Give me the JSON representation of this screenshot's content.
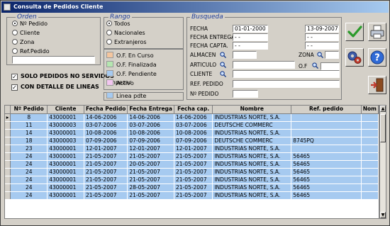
{
  "window": {
    "title": "Consulta de Pedidos Cliente"
  },
  "orden": {
    "legend": "Orden",
    "options": [
      "Nº Pedido",
      "Cliente",
      "Zona",
      "Ref.Pedido"
    ],
    "selected": 0,
    "input_value": ""
  },
  "checks": {
    "solo_pedidos": {
      "label": "SOLO PEDIDOS NO SERVIDOS",
      "checked": true
    },
    "con_detalle": {
      "label": "CON DETALLE DE LINEAS",
      "checked": true
    }
  },
  "rango": {
    "legend": "Rango",
    "options": [
      "Todos",
      "Nacionales",
      "Extranjeros"
    ],
    "selected": 0
  },
  "status_legend": [
    {
      "label": "O.F. En Curso",
      "color": "#f4c69f"
    },
    {
      "label": "O.F. Finalizada",
      "color": "#b5e6b0"
    },
    {
      "label": "O.F. Pendiente Empezar",
      "color": "#a6caf0"
    },
    {
      "label": "Activo",
      "color": "#f2c6f0"
    }
  ],
  "linea_pdte": {
    "label": "Linea pdte",
    "color": "#a6caf0"
  },
  "busqueda": {
    "legend": "Busqueda",
    "fecha_label": "FECHA",
    "fecha_from": "01-01-2000",
    "fecha_to": "13-09-2007",
    "fecha_entrega_label": "FECHA ENTREGA",
    "fecha_entrega_from": " - -",
    "fecha_entrega_to": " - -",
    "fecha_capta_label": "FECHA CAPTA.",
    "fecha_capta_from": " - -",
    "fecha_capta_to": " - -",
    "almacen_label": "ALMACEN",
    "almacen_value": "",
    "zona_label": "ZONA",
    "zona_value": "",
    "articulo_label": "ARTICULO",
    "articulo_value": "",
    "of_label": "O.F",
    "of_value": "",
    "cliente_label": "CLIENTE",
    "cliente_value": "",
    "ref_pedido_label": "REF. PEDIDO",
    "ref_pedido_value": "",
    "n_pedido_label": "Nº PEDIDO",
    "n_pedido_value": ""
  },
  "grid": {
    "columns": [
      "Nº Pedido",
      "Cliente",
      "Fecha Pedido",
      "Fecha Entrega",
      "Fecha cap.",
      "Nombre",
      "Ref. pedido",
      "Nom"
    ],
    "rows": [
      [
        "8",
        "43000001",
        "14-06-2006",
        "14-06-2006",
        "14-06-2006",
        "INDUSTRIAS NORTE, S.A.",
        "",
        ""
      ],
      [
        "11",
        "43000003",
        "03-07-2006",
        "03-07-2006",
        "03-07-2006",
        "DEUTSCHE COMMERC",
        "",
        ""
      ],
      [
        "14",
        "43000001",
        "10-08-2006",
        "10-08-2006",
        "10-08-2006",
        "INDUSTRIAS NORTE, S.A.",
        "",
        ""
      ],
      [
        "18",
        "43000003",
        "07-09-2006",
        "07-09-2006",
        "07-09-2006",
        "DEUTSCHE COMMERC",
        "8745PQ",
        ""
      ],
      [
        "23",
        "43000001",
        "12-01-2007",
        "12-01-2007",
        "12-01-2007",
        "INDUSTRIAS NORTE, S.A.",
        "",
        ""
      ],
      [
        "24",
        "43000001",
        "21-05-2007",
        "21-05-2007",
        "21-05-2007",
        "INDUSTRIAS NORTE, S.A.",
        "56465",
        ""
      ],
      [
        "24",
        "43000001",
        "21-05-2007",
        "20-05-2007",
        "21-05-2007",
        "INDUSTRIAS NORTE, S.A.",
        "56465",
        ""
      ],
      [
        "24",
        "43000001",
        "21-05-2007",
        "21-05-2007",
        "21-05-2007",
        "INDUSTRIAS NORTE, S.A.",
        "56465",
        ""
      ],
      [
        "24",
        "43000001",
        "21-05-2007",
        "21-05-2007",
        "21-05-2007",
        "INDUSTRIAS NORTE, S.A.",
        "56465",
        ""
      ],
      [
        "24",
        "43000001",
        "21-05-2007",
        "28-05-2007",
        "21-05-2007",
        "INDUSTRIAS NORTE, S.A.",
        "56465",
        ""
      ],
      [
        "24",
        "43000001",
        "21-05-2007",
        "21-05-2007",
        "21-05-2007",
        "INDUSTRIAS NORTE, S.A.",
        "56465",
        ""
      ]
    ],
    "selected_row": 0
  },
  "toolbar": {
    "accept_icon": "check-icon",
    "print_icon": "printer-icon",
    "config_icon": "gears-icon",
    "help_icon": "help-icon",
    "exit_icon": "exit-door-icon"
  }
}
